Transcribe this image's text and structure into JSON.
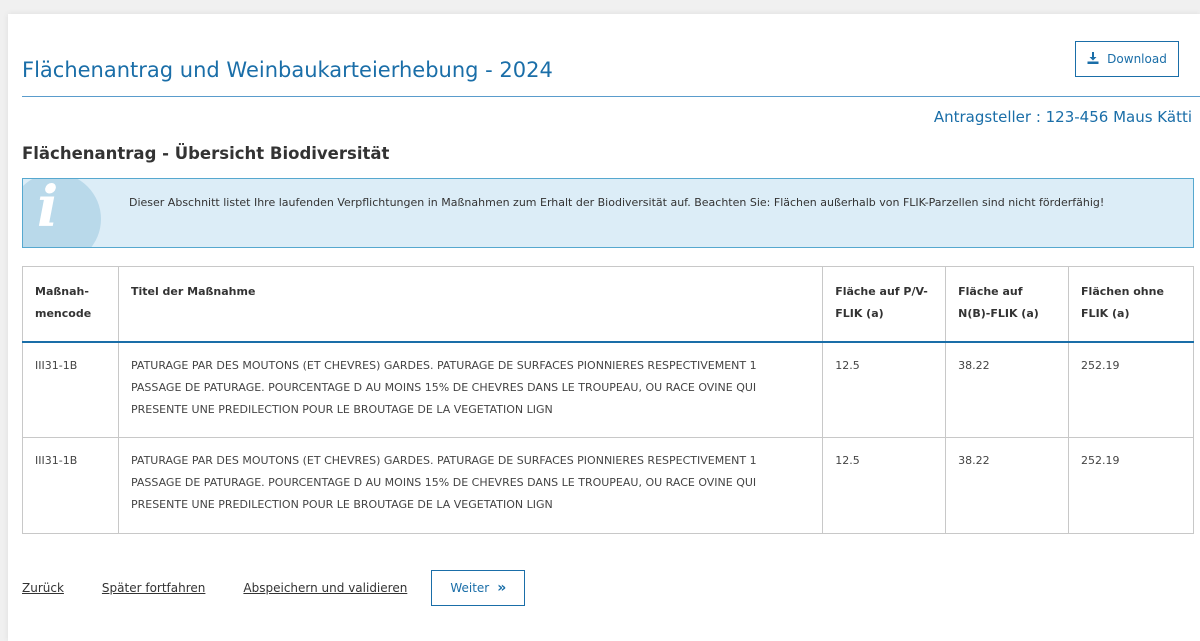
{
  "header": {
    "title": "Flächenantrag und Weinbaukarteierhebung - 2024",
    "download_label": "Download",
    "applicant": "Antragsteller : 123-456 Maus Kätti"
  },
  "section": {
    "title": "Flächenantrag - Übersicht Biodiversität"
  },
  "info": {
    "text": "Dieser Abschnitt listet Ihre laufenden Verpflichtungen in Maßnahmen zum Erhalt der Biodiversität auf. Beachten Sie: Flächen außerhalb von FLIK-Parzellen sind nicht förderfähig!"
  },
  "table": {
    "headers": {
      "code": "Maßnah-mencode",
      "title": "Titel der Maßnahme",
      "pv": "Fläche auf P/V-FLIK (a)",
      "nb": "Fläche auf N(B)-FLIK (a)",
      "none": "Flächen ohne FLIK (a)"
    },
    "rows": [
      {
        "code": "III31-1B",
        "title": "PATURAGE PAR DES MOUTONS (ET CHEVRES) GARDES. PATURAGE DE SURFACES PIONNIERES RESPECTIVEMENT 1 PASSAGE DE PATURAGE. POURCENTAGE D AU MOINS 15% DE CHEVRES DANS LE TROUPEAU, OU RACE OVINE QUI PRESENTE UNE PREDILECTION POUR LE BROUTAGE DE LA VEGETATION LIGN",
        "pv": "12.5",
        "nb": "38.22",
        "none": "252.19"
      },
      {
        "code": "III31-1B",
        "title": "PATURAGE PAR DES MOUTONS (ET CHEVRES) GARDES. PATURAGE DE SURFACES PIONNIERES RESPECTIVEMENT 1 PASSAGE DE PATURAGE. POURCENTAGE D AU MOINS 15% DE CHEVRES DANS LE TROUPEAU, OU RACE OVINE QUI PRESENTE UNE PREDILECTION POUR LE BROUTAGE DE LA VEGETATION LIGN",
        "pv": "12.5",
        "nb": "38.22",
        "none": "252.19"
      }
    ]
  },
  "footer": {
    "back_label": "Zurück",
    "later_label": "Später fortfahren",
    "save_label": "Abspeichern und validieren",
    "next_label": "Weiter",
    "next_icon": "»"
  },
  "icons": {
    "download": "download-icon",
    "info": "info-icon",
    "next": "double-chevron-right-icon"
  },
  "colors": {
    "accent": "#1a6ea8",
    "info_bg": "#dcedf7",
    "info_border": "#56a8cf",
    "page_bg": "#f0f0f0"
  }
}
